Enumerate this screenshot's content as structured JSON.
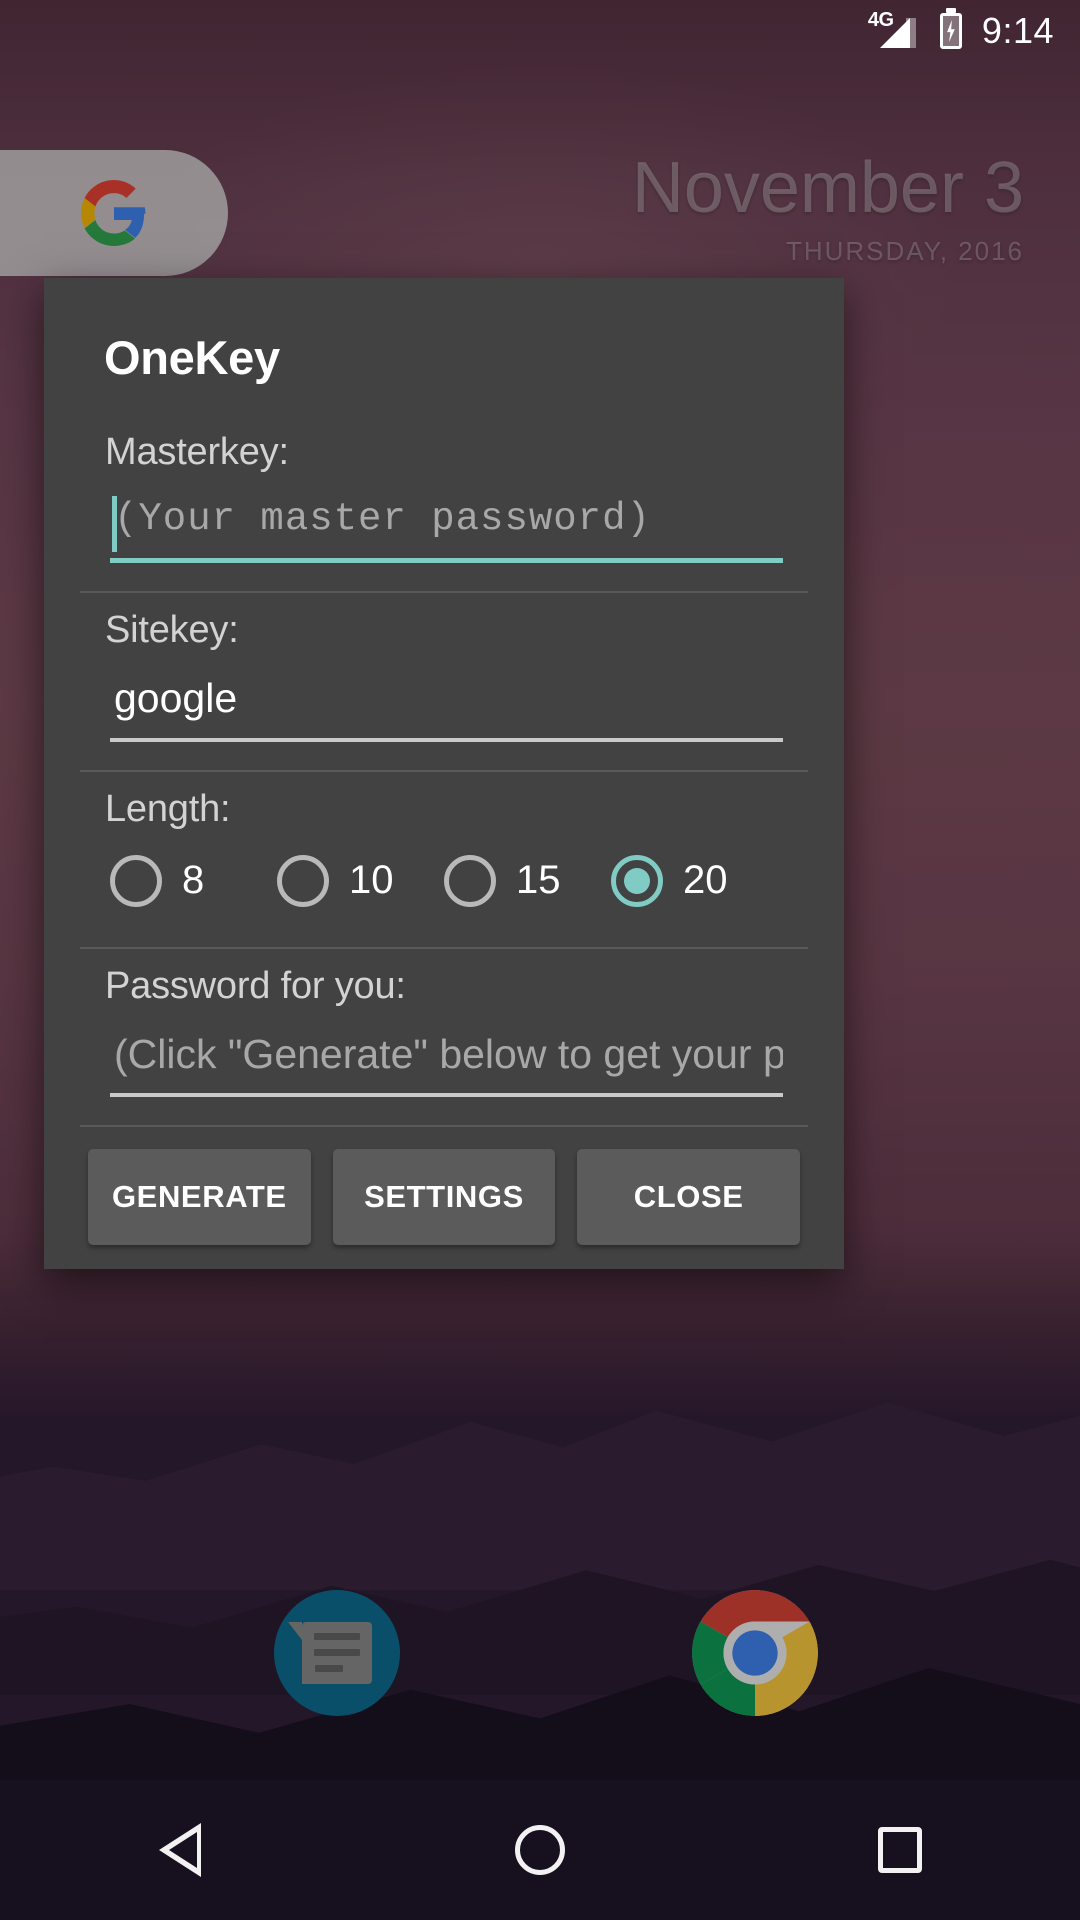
{
  "status_bar": {
    "network_label": "4G",
    "time": "9:14",
    "signal_icon": "signal-bars-icon",
    "battery_icon": "battery-charging-icon"
  },
  "home_screen": {
    "search_widget": {
      "icon": "google-g-icon"
    },
    "date_widget": {
      "date": "November 3",
      "subtitle": "THURSDAY, 2016"
    },
    "dock": [
      {
        "name": "messages",
        "icon": "messages-icon"
      },
      {
        "name": "chrome",
        "icon": "chrome-icon"
      }
    ]
  },
  "nav_bar": {
    "back": "back-triangle-icon",
    "home": "home-circle-icon",
    "recents": "recents-square-icon"
  },
  "dialog": {
    "title": "OneKey",
    "fields": {
      "masterkey": {
        "label": "Masterkey:",
        "value": "",
        "placeholder": "(Your master password)",
        "focused": true
      },
      "sitekey": {
        "label": "Sitekey:",
        "value": "google",
        "placeholder": "",
        "focused": false
      },
      "password": {
        "label": "Password for you:",
        "value": "",
        "placeholder": "(Click \"Generate\" below to get your pa",
        "focused": false
      }
    },
    "length": {
      "label": "Length:",
      "selected": "20",
      "options": [
        {
          "value": "8",
          "selected": false
        },
        {
          "value": "10",
          "selected": false
        },
        {
          "value": "15",
          "selected": false
        },
        {
          "value": "20",
          "selected": true
        }
      ]
    },
    "buttons": {
      "generate": "GENERATE",
      "settings": "SETTINGS",
      "close": "CLOSE"
    }
  },
  "colors": {
    "accent_teal": "#80cbc4",
    "dialog_bg": "#424242",
    "button_bg": "#5b5b5b",
    "label_gray": "#d3d3d3",
    "placeholder_gray": "#a8a8a8"
  }
}
